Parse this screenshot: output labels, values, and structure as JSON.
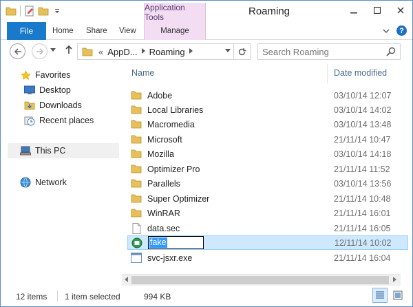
{
  "window": {
    "title": "Roaming",
    "contextual_group": "Application Tools",
    "controls": [
      "minimize",
      "maximize",
      "close"
    ]
  },
  "ribbon": {
    "file_tab": "File",
    "tabs": [
      {
        "label": "Home"
      },
      {
        "label": "Share"
      },
      {
        "label": "View"
      },
      {
        "label": "Manage"
      }
    ]
  },
  "address": {
    "prefix": "«",
    "crumbs": [
      "AppD...",
      "Roaming"
    ],
    "search_placeholder": "Search Roaming"
  },
  "nav_pane": {
    "items": [
      {
        "label": "Favorites",
        "icon": "star-icon"
      },
      {
        "label": "Desktop",
        "icon": "desktop-icon"
      },
      {
        "label": "Downloads",
        "icon": "downloads-icon"
      },
      {
        "label": "Recent places",
        "icon": "recent-places-icon"
      },
      {
        "label": "This PC",
        "icon": "computer-icon"
      },
      {
        "label": "Network",
        "icon": "network-icon"
      }
    ]
  },
  "file_list": {
    "columns": {
      "name": "Name",
      "date": "Date modified"
    },
    "rows": [
      {
        "name": "Adobe",
        "date": "03/10/14 12:07",
        "type": "folder"
      },
      {
        "name": "Local Libraries",
        "date": "03/10/14 14:02",
        "type": "folder"
      },
      {
        "name": "Macromedia",
        "date": "03/10/14 13:48",
        "type": "folder"
      },
      {
        "name": "Microsoft",
        "date": "21/11/14 10:47",
        "type": "folder"
      },
      {
        "name": "Mozilla",
        "date": "03/10/14 14:18",
        "type": "folder"
      },
      {
        "name": "Optimizer Pro",
        "date": "21/11/14 11:52",
        "type": "folder"
      },
      {
        "name": "Parallels",
        "date": "03/10/14 13:56",
        "type": "folder"
      },
      {
        "name": "Super Optimizer",
        "date": "21/11/14 10:48",
        "type": "folder"
      },
      {
        "name": "WinRAR",
        "date": "21/11/14 16:01",
        "type": "folder"
      },
      {
        "name": "data.sec",
        "date": "21/11/14 16:05",
        "type": "file"
      },
      {
        "name": "fake",
        "date": "12/11/14 10:02",
        "type": "app-renaming"
      },
      {
        "name": "svc-jsxr.exe",
        "date": "21/11/14 16:04",
        "type": "exe"
      }
    ]
  },
  "status": {
    "item_count": "12 items",
    "selection": "1 item selected",
    "size": "994 KB"
  },
  "colors": {
    "file_tab": "#1979ca",
    "contextual": "#f2ddf3",
    "selection": "#cde8ff",
    "header_text": "#4b6b8c"
  }
}
